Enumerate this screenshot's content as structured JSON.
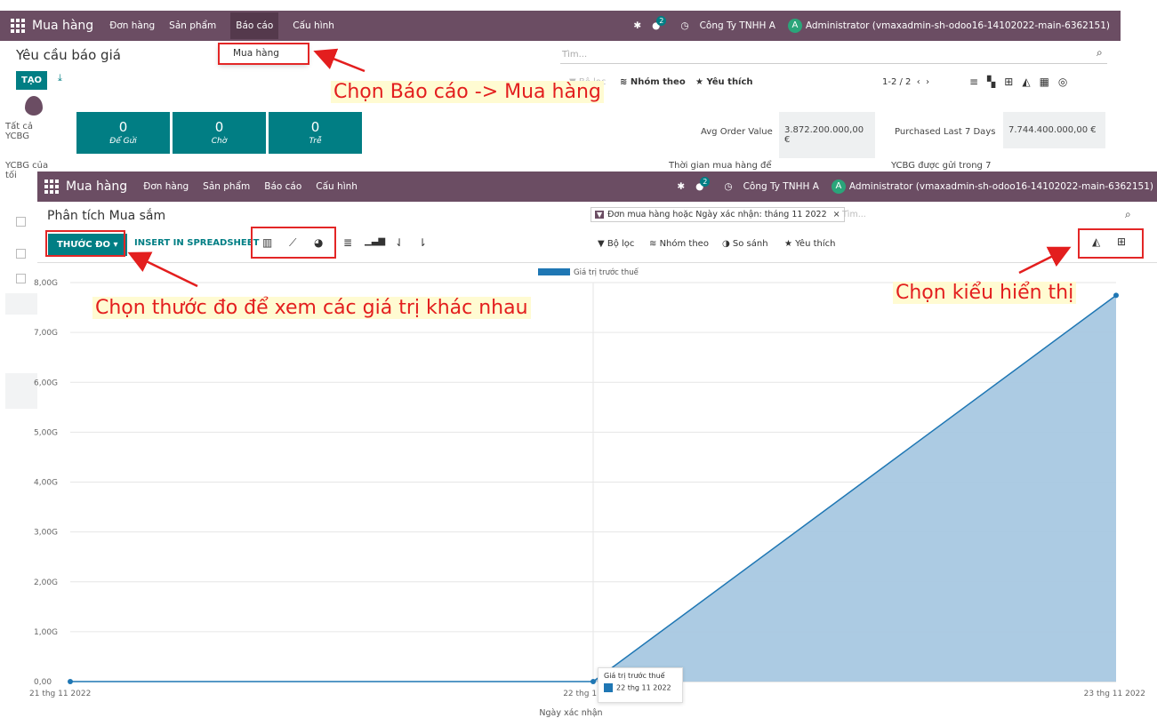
{
  "back": {
    "navbar": {
      "brand": "Mua hàng",
      "menus": [
        "Đơn hàng",
        "Sản phẩm",
        "Báo cáo",
        "Cấu hình"
      ],
      "badge": "2",
      "company": "Công Ty TNHH A",
      "avatar": "A",
      "user": "Administrator (vmaxadmin-sh-odoo16-14102022-main-6362151)"
    },
    "dropdown_item": "Mua hàng",
    "title": "Yêu cầu báo giá",
    "create": "TẠO",
    "search_placeholder": "Tìm...",
    "filter": "Bộ lọc",
    "group": "Nhóm theo",
    "favorite": "Yêu thích",
    "pager": "1-2 / 2",
    "sidebar": {
      "all_rfq": "Tất cả\nYCBG",
      "my_rfq": "YCBG của\ntối"
    },
    "kpis": [
      {
        "value": "0",
        "label": "Để Gửi"
      },
      {
        "value": "0",
        "label": "Chờ"
      },
      {
        "value": "0",
        "label": "Trễ"
      }
    ],
    "stats": {
      "avg_label": "Avg Order Value",
      "avg_value": "3.872.200.000,00 €",
      "purchased_label": "Purchased Last 7 Days",
      "purchased_value": "7.744.400.000,00 €",
      "lead_label": "Thời gian mua hàng để",
      "sent_label": "YCBG được gửi trong 7"
    }
  },
  "front": {
    "navbar": {
      "brand": "Mua hàng",
      "menus": [
        "Đơn hàng",
        "Sản phẩm",
        "Báo cáo",
        "Cấu hình"
      ],
      "badge": "2",
      "company": "Công Ty TNHH A",
      "avatar": "A",
      "user": "Administrator (vmaxadmin-sh-odoo16-14102022-main-6362151)"
    },
    "title": "Phân tích Mua sắm",
    "measure_btn": "THƯỚC ĐO",
    "insert_btn": "INSERT IN SPREADSHEET",
    "facet": "Đơn mua hàng hoặc Ngày xác nhận: tháng 11 2022",
    "facet_close": "×",
    "search_placeholder": "Tìm...",
    "filter": "Bộ lọc",
    "group": "Nhóm theo",
    "compare": "So sánh",
    "favorite": "Yêu thích",
    "tooltip": {
      "title": "Giá trị trước thuế",
      "item": "22 thg 11 2022"
    }
  },
  "annotations": {
    "report": "Chọn Báo cáo -> Mua hàng",
    "measure": "Chọn thước đo để xem các giá trị khác nhau",
    "view": "Chọn kiểu hiển thị"
  },
  "colors": {
    "navbar": "#6b4d63",
    "accent": "#017e84",
    "series": "#1f77b4",
    "area_fill": "#a8c8e1",
    "annotation": "#e31e1e"
  },
  "chart_data": {
    "type": "area",
    "x": [
      "21 thg 11 2022",
      "22 thg 11 2022",
      "23 thg 11 2022"
    ],
    "x_tick_labels": [
      "21 thg 11 2022",
      "22 thg 11",
      "23 thg 11 2022"
    ],
    "series": [
      {
        "name": "Giá trị trước thuế",
        "values": [
          0,
          0,
          7744400000
        ]
      }
    ],
    "y_ticks": [
      "0,00",
      "1,00G",
      "2,00G",
      "3,00G",
      "4,00G",
      "5,00G",
      "6,00G",
      "7,00G",
      "8,00G"
    ],
    "ylim": [
      0,
      8000000000
    ],
    "xlabel": "Ngày xác nhận",
    "ylabel": "",
    "grid": true,
    "legend_position": "top-center"
  }
}
